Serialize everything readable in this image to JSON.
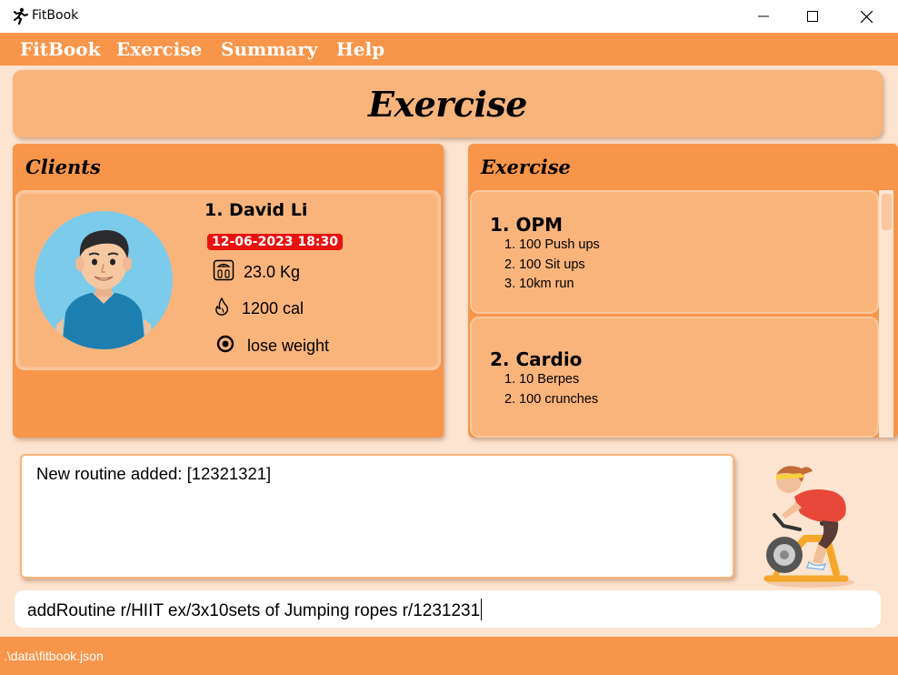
{
  "window": {
    "title": "FitBook",
    "app_icon": "running-person-icon",
    "controls": [
      "minimize-icon",
      "maximize-icon",
      "close-icon"
    ]
  },
  "menu": {
    "items": [
      {
        "label": "FitBook"
      },
      {
        "label": "Exercise"
      },
      {
        "label": "Summary"
      },
      {
        "label": "Help"
      }
    ]
  },
  "header": {
    "title": "Exercise"
  },
  "clients": {
    "title": "Clients",
    "items": [
      {
        "index_name": "1.  David Li",
        "date": "12-06-2023 18:30",
        "weight": "23.0 Kg",
        "calories": "1200 cal",
        "goal": "lose weight",
        "icons": {
          "weight": "scale-icon",
          "calories": "flame-icon",
          "goal": "target-icon",
          "avatar": "avatar-man"
        }
      }
    ]
  },
  "exercise": {
    "title": "Exercise",
    "items": [
      {
        "name": "1.  OPM",
        "steps": [
          "1. 100 Push ups",
          "2. 100 Sit ups",
          "3. 10km run"
        ]
      },
      {
        "name": "2.  Cardio",
        "steps": [
          "1. 10 Berpes",
          "2. 100 crunches"
        ]
      }
    ]
  },
  "result": {
    "text": "New routine added: [12321321]"
  },
  "command": {
    "value": "addRoutine r/HIIT ex/3x10sets of Jumping ropes r/1231231"
  },
  "status": {
    "path": ".\\data\\fitbook.json"
  },
  "colors": {
    "menubar": "#f7954a",
    "card": "#f9b47c",
    "background": "#fde4d0",
    "date_badge": "#e8120f"
  }
}
